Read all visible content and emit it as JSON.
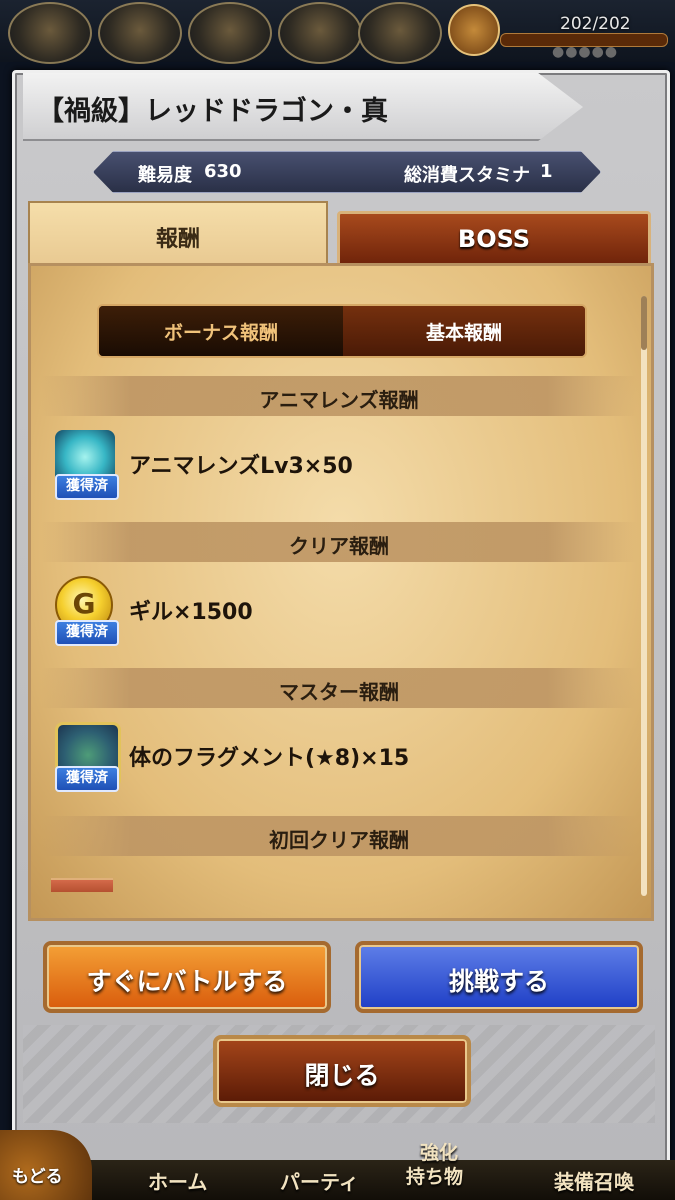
{
  "status": {
    "stamina": "202/202",
    "stamina_dots": "●●●●●"
  },
  "dialog": {
    "title": "【禍級】レッドドラゴン・真",
    "difficulty_label": "難易度",
    "difficulty_value": "630",
    "stamina_label": "総消費スタミナ",
    "stamina_value": "1"
  },
  "tabs": {
    "reward": "報酬",
    "boss": "BOSS"
  },
  "segments": {
    "bonus": "ボーナス報酬",
    "basic": "基本報酬"
  },
  "sections": [
    {
      "header": "アニマレンズ報酬",
      "item": "アニマレンズLv3×50",
      "badge": "獲得済",
      "icon": "crystal-icon"
    },
    {
      "header": "クリア報酬",
      "item": "ギル×1500",
      "badge": "獲得済",
      "icon": "gil-coin-icon",
      "icon_glyph": "G"
    },
    {
      "header": "マスター報酬",
      "item": "体のフラグメント(★8)×15",
      "badge": "獲得済",
      "icon": "fragment-icon"
    },
    {
      "header": "初回クリア報酬"
    }
  ],
  "buttons": {
    "quick_battle": "すぐにバトルする",
    "challenge": "挑戦する",
    "close": "閉じる"
  },
  "nav": {
    "back": "もどる",
    "home": "ホーム",
    "party": "パーティ",
    "enhance_line1": "強化",
    "enhance_line2": "持ち物",
    "equip_summon": "装備召喚"
  },
  "colors": {
    "accent_orange": "#e27a1c",
    "accent_blue": "#3a5ad6",
    "obtained_badge": "#2c63cc"
  }
}
